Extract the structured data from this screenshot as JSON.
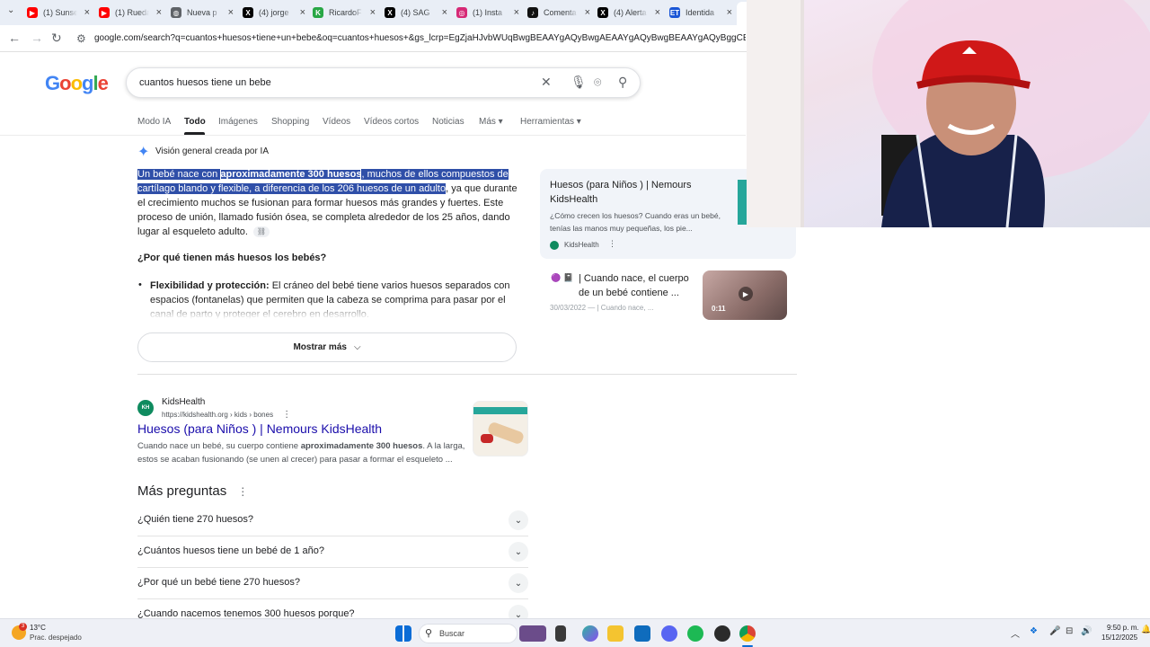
{
  "browser": {
    "tabs": [
      {
        "title": "(1) Sunse",
        "color": "#ff0000",
        "glyph": "▶"
      },
      {
        "title": "(1) Rueda",
        "color": "#ff0000",
        "glyph": "▶"
      },
      {
        "title": "Nueva p",
        "color": "#5f6368",
        "glyph": "◍"
      },
      {
        "title": "(4) jorge",
        "color": "#000000",
        "glyph": "X"
      },
      {
        "title": "RicardoF",
        "color": "#28a745",
        "glyph": "K"
      },
      {
        "title": "(4) SAG",
        "color": "#000000",
        "glyph": "X"
      },
      {
        "title": "(1) Insta",
        "color": "#d62976",
        "glyph": "◎"
      },
      {
        "title": "Comenta",
        "color": "#111111",
        "glyph": "♪"
      },
      {
        "title": "(4) Alerta",
        "color": "#000000",
        "glyph": "X"
      },
      {
        "title": "Identida",
        "color": "#1a56d6",
        "glyph": "ET"
      }
    ],
    "url": "google.com/search?q=cuantos+huesos+tiene+un+bebe&oq=cuantos+huesos+&gs_lcrp=EgZjaHJvbWUqBwgBEAAYgAQyBwgAEAAYgAQyBwgBEAAYgAQyBggCEEUYOTIHCAMQ"
  },
  "google": {
    "logo": "Google",
    "query": "cuantos huesos tiene un bebe",
    "tabs": [
      "Modo IA",
      "Todo",
      "Imágenes",
      "Shopping",
      "Vídeos",
      "Vídeos cortos",
      "Noticias",
      "Más ▾",
      "Herramientas ▾"
    ],
    "active_tab": "Todo"
  },
  "ai_overview": {
    "title": "Visión general creada por IA",
    "p1_hl1": "Un bebé nace con ",
    "p1_bold": "aproximadamente 300 huesos",
    "p1_hl2": ", muchos de ellos compuestos de cartílago blando y flexible, a diferencia de los 206 huesos de un adulto",
    "p1_rest": ", ya que durante el crecimiento muchos se fusionan para formar huesos más grandes y fuertes. Este proceso de unión, llamado fusión ósea, se completa alrededor de los 25 años, dando lugar al esqueleto adulto.",
    "question": "¿Por qué tienen más huesos los bebés?",
    "bullet_bold": "Flexibilidad y protección:",
    "bullet_text": " El cráneo del bebé tiene varios huesos separados con espacios (fontanelas) que permiten que la cabeza se comprima para pasar por el canal de parto y proteger el cerebro en desarrollo.",
    "more_button": "Mostrar más",
    "card1": {
      "title": "Huesos (para Niños ) | Nemours KidsHealth",
      "snippet": "¿Cómo crecen los huesos? Cuando eras un bebé, tenías las manos muy pequeñas, los pie...",
      "source": "KidsHealth"
    },
    "card2": {
      "title": "| Cuando nace, el cuerpo de un bebé contiene ...",
      "meta": "30/03/2022 — | Cuando nace, ...",
      "duration": "0:11"
    }
  },
  "result": {
    "site": "KidsHealth",
    "url": "https://kidshealth.org › kids › bones",
    "title": "Huesos (para Niños ) | Nemours KidsHealth",
    "snippet_a": "Cuando nace un bebé, su cuerpo contiene ",
    "snippet_bold": "aproximadamente 300 huesos",
    "snippet_b": ". A la larga, estos se acaban fusionando (se unen al crecer) para pasar a formar el esqueleto ..."
  },
  "paa": {
    "title": "Más preguntas",
    "questions": [
      "¿Quién tiene 270 huesos?",
      "¿Cuántos huesos tiene un bebé de 1 año?",
      "¿Por qué un bebé tiene 270 huesos?",
      "¿Cuando nacemos tenemos 300 huesos porque?"
    ]
  },
  "taskbar": {
    "weather_temp": "13°C",
    "weather_desc": "Prac. despejado",
    "weather_badge": "3",
    "search_label": "Buscar",
    "time": "9:50 p. m.",
    "date": "15/12/2025"
  }
}
